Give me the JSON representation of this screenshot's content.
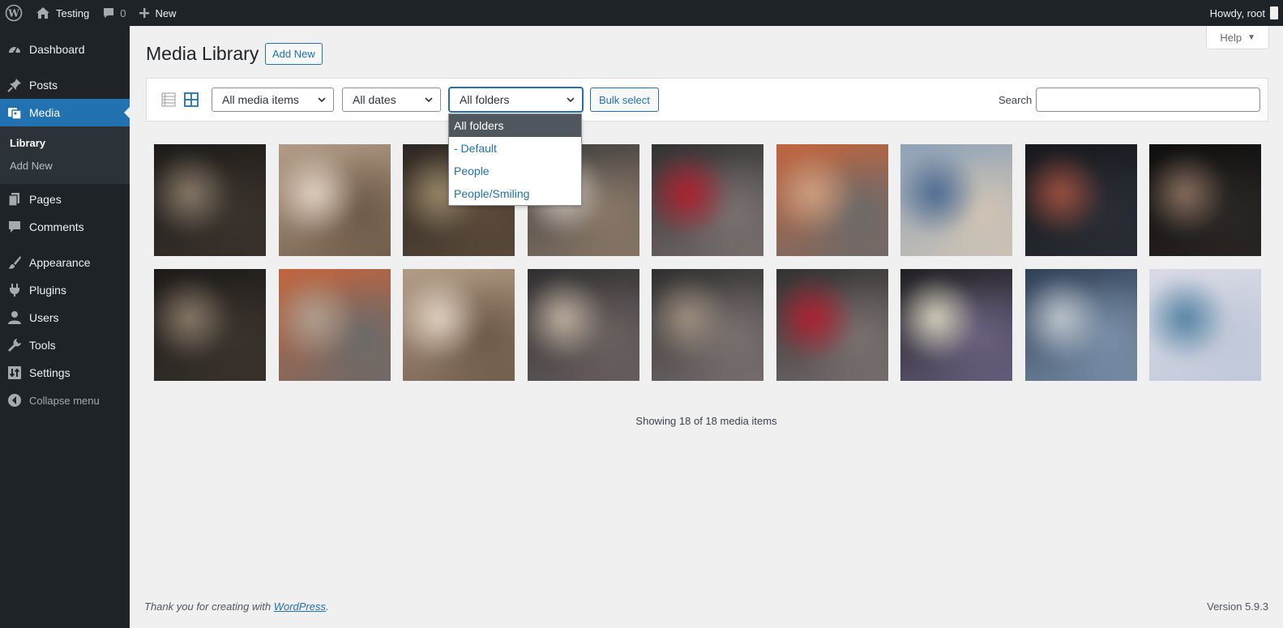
{
  "admin_bar": {
    "site_name": "Testing",
    "comments_count": "0",
    "new_label": "New",
    "greeting": "Howdy, root"
  },
  "sidebar": {
    "items": [
      {
        "label": "Dashboard",
        "icon": "dashboard-icon"
      },
      {
        "label": "Posts",
        "icon": "pin-icon"
      },
      {
        "label": "Media",
        "icon": "media-icon",
        "current": true
      },
      {
        "label": "Pages",
        "icon": "pages-icon"
      },
      {
        "label": "Comments",
        "icon": "comment-icon"
      },
      {
        "label": "Appearance",
        "icon": "brush-icon"
      },
      {
        "label": "Plugins",
        "icon": "plug-icon"
      },
      {
        "label": "Users",
        "icon": "user-icon"
      },
      {
        "label": "Tools",
        "icon": "wrench-icon"
      },
      {
        "label": "Settings",
        "icon": "settings-icon"
      }
    ],
    "submenu": [
      {
        "label": "Library",
        "current": true
      },
      {
        "label": "Add New"
      }
    ],
    "collapse_label": "Collapse menu"
  },
  "header": {
    "title": "Media Library",
    "add_new_label": "Add New",
    "help_label": "Help"
  },
  "toolbar": {
    "type_filter": "All media items",
    "date_filter": "All dates",
    "folder_filter": "All folders",
    "bulk_select_label": "Bulk select",
    "search_label": "Search",
    "search_value": ""
  },
  "folder_dropdown": {
    "options": [
      "All folders",
      "- Default",
      "People",
      "People/Smiling"
    ],
    "selected_index": 0
  },
  "media": {
    "thumbnails": [
      {
        "colors": [
          "#1b1917",
          "#3a332c",
          "#8a7a6a"
        ]
      },
      {
        "colors": [
          "#b8a28c",
          "#6e5a48",
          "#e0d2c2"
        ]
      },
      {
        "colors": [
          "#2a2420",
          "#5a4a3a",
          "#9a8a6a"
        ]
      },
      {
        "colors": [
          "#3a3a3a",
          "#8a7868",
          "#d0c8c0"
        ]
      },
      {
        "colors": [
          "#2c2c2c",
          "#7a7070",
          "#b02030"
        ]
      },
      {
        "colors": [
          "#c8643a",
          "#6a6a6a",
          "#d0a080"
        ]
      },
      {
        "colors": [
          "#8aa0b8",
          "#d0c4b4",
          "#4a6890"
        ]
      },
      {
        "colors": [
          "#15171c",
          "#2a2d35",
          "#a05040"
        ]
      },
      {
        "colors": [
          "#0c0c0c",
          "#2a2624",
          "#8a7060"
        ]
      },
      {
        "colors": [
          "#1b1917",
          "#3a332c",
          "#8a7a6a"
        ]
      },
      {
        "colors": [
          "#c8643a",
          "#6a6a6a",
          "#b0a090"
        ]
      },
      {
        "colors": [
          "#b8a28c",
          "#6e5a48",
          "#e0d2c2"
        ]
      },
      {
        "colors": [
          "#2c2c2c",
          "#6a6060",
          "#c0b0a0"
        ]
      },
      {
        "colors": [
          "#2a2a2a",
          "#7a7070",
          "#a09080"
        ]
      },
      {
        "colors": [
          "#2c2c2c",
          "#7a7070",
          "#b02030"
        ]
      },
      {
        "colors": [
          "#1a1a1a",
          "#6a6080",
          "#d8d4c0"
        ]
      },
      {
        "colors": [
          "#2a3a50",
          "#7a90a8",
          "#c0c8d0"
        ]
      },
      {
        "colors": [
          "#dcdce8",
          "#c0c8d8",
          "#5080a0"
        ]
      }
    ],
    "showing_text": "Showing 18 of 18 media items"
  },
  "footer": {
    "thanks_prefix": "Thank you for creating with ",
    "thanks_link": "WordPress",
    "thanks_suffix": ".",
    "version": "Version 5.9.3"
  },
  "colors": {
    "accent": "#2271b1",
    "admin_bar_bg": "#1d2327",
    "page_bg": "#f0f0f1"
  }
}
